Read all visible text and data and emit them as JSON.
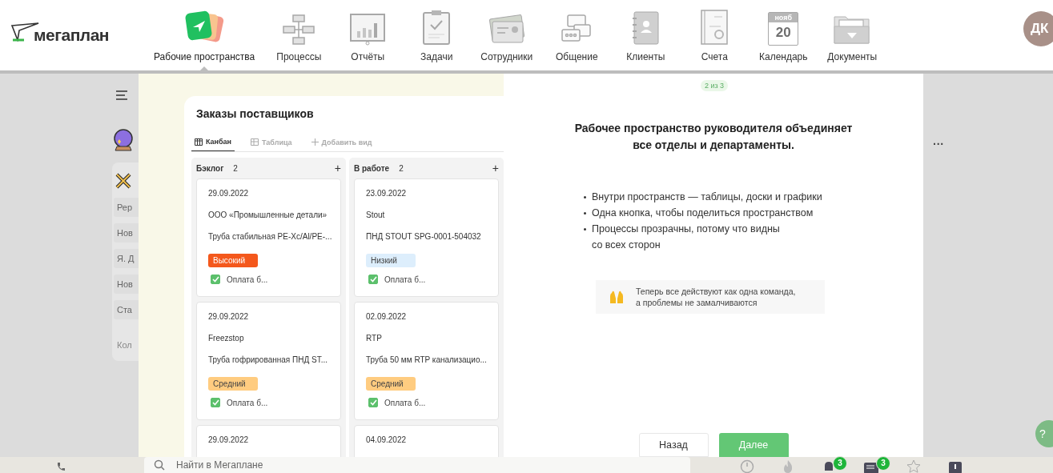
{
  "logo": {
    "text": "мегаплан"
  },
  "nav": [
    {
      "label": "Рабочие пространства",
      "selected": true
    },
    {
      "label": "Процессы",
      "selected": false
    },
    {
      "label": "Отчёты",
      "selected": false
    },
    {
      "label": "Задачи",
      "selected": false
    },
    {
      "label": "Сотрудники",
      "selected": false
    },
    {
      "label": "Общение",
      "selected": false
    },
    {
      "label": "Клиенты",
      "selected": false
    },
    {
      "label": "Счета",
      "selected": false
    },
    {
      "label": "Календарь",
      "selected": false,
      "month": "нояб",
      "day": "20"
    },
    {
      "label": "Документы",
      "selected": false
    }
  ],
  "avatar": {
    "initials": "ДК"
  },
  "sidebar": {
    "items": [
      "Рер",
      "Нов",
      "Я. Д",
      "Нов",
      "Ста"
    ],
    "footer": "Кол"
  },
  "more": {
    "label": "···"
  },
  "preview": {
    "title": "Заказы поставщиков",
    "tabs": [
      {
        "label": "Канбан",
        "selected": true,
        "kind": "board"
      },
      {
        "label": "Таблица",
        "selected": false,
        "kind": "table"
      },
      {
        "label": "Добавить вид",
        "selected": false,
        "kind": "add"
      }
    ],
    "add_symbol": "+",
    "columns": [
      {
        "title": "Бэклог",
        "count": "2",
        "cards": [
          {
            "date": "29.09.2022",
            "company": "ООО «Промышленные детали»",
            "product": "Труба стабильная PE-Xc/Al/PE-...",
            "tag": {
              "label": "Высокий",
              "kind": "high"
            },
            "task": {
              "label": "Оплата б...",
              "checked": true
            }
          },
          {
            "date": "29.09.2022",
            "company": "Freezstop",
            "product": "Труба гофрированная ПНД ST...",
            "tag": {
              "label": "Средний",
              "kind": "medium"
            },
            "task": {
              "label": "Оплата б...",
              "checked": true
            }
          },
          {
            "date": "29.09.2022"
          }
        ]
      },
      {
        "title": "В работе",
        "count": "2",
        "cards": [
          {
            "date": "23.09.2022",
            "company": "Stout",
            "product": "ПНД STOUT SPG-0001-504032",
            "tag": {
              "label": "Низкий",
              "kind": "low"
            },
            "task": {
              "label": "Оплата б...",
              "checked": true
            }
          },
          {
            "date": "02.09.2022",
            "company": "RTP",
            "product": "Труба 50 мм RTP канализацио...",
            "tag": {
              "label": "Средний",
              "kind": "medium"
            },
            "task": {
              "label": "Оплата б...",
              "checked": true
            }
          },
          {
            "date": "04.09.2022"
          }
        ]
      }
    ]
  },
  "step": {
    "label": "2 из 3"
  },
  "heading_lines": [
    "Рабочее пространство руководителя объединяет",
    "все отделы и департаменты."
  ],
  "bullets": [
    {
      "lines": [
        "Внутри пространств — таблицы, доски и графики"
      ]
    },
    {
      "lines": [
        "Одна кнопка, чтобы поделиться пространством"
      ]
    },
    {
      "lines": [
        "Процессы прозрачны, потому что видны",
        "со всех сторон"
      ]
    }
  ],
  "note": {
    "lines": [
      "Теперь все действуют как одна команда,",
      "а проблемы не замалчиваются"
    ]
  },
  "buttons": [
    {
      "label": "Назад",
      "kind": "secondary"
    },
    {
      "label": "Далее",
      "kind": "primary"
    }
  ],
  "help": {
    "label": "?"
  },
  "search": {
    "placeholder": "Найти в Мегаплане"
  },
  "bottom_badges": {
    "notifications": "3",
    "messages": "3"
  }
}
